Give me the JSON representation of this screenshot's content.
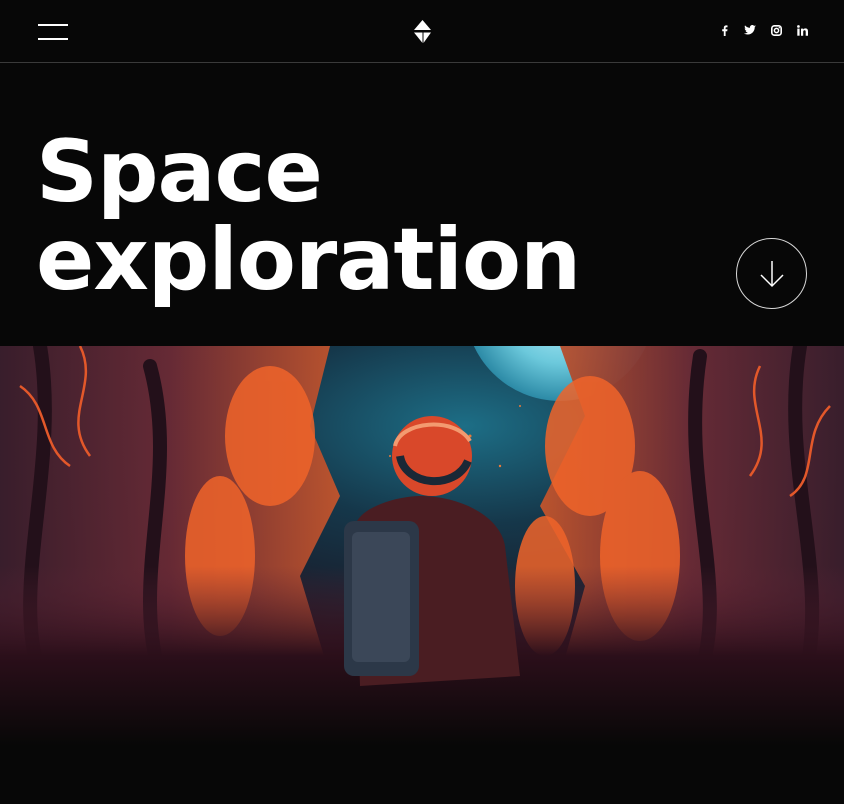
{
  "header": {
    "menu_icon": "hamburger-icon",
    "logo_icon": "four-point-star-logo",
    "social": [
      {
        "name": "facebook",
        "icon": "facebook-icon"
      },
      {
        "name": "twitter",
        "icon": "twitter-icon"
      },
      {
        "name": "instagram",
        "icon": "instagram-icon"
      },
      {
        "name": "linkedin",
        "icon": "linkedin-icon"
      }
    ]
  },
  "hero": {
    "title_line1": "Space",
    "title_line2": "exploration",
    "scroll_icon": "arrow-down-icon",
    "image_subject": "astronaut-in-forest"
  },
  "colors": {
    "background": "#070707",
    "text": "#ffffff",
    "accent_orange": "#e8582a",
    "moon_blue": "#7fd3e6"
  }
}
